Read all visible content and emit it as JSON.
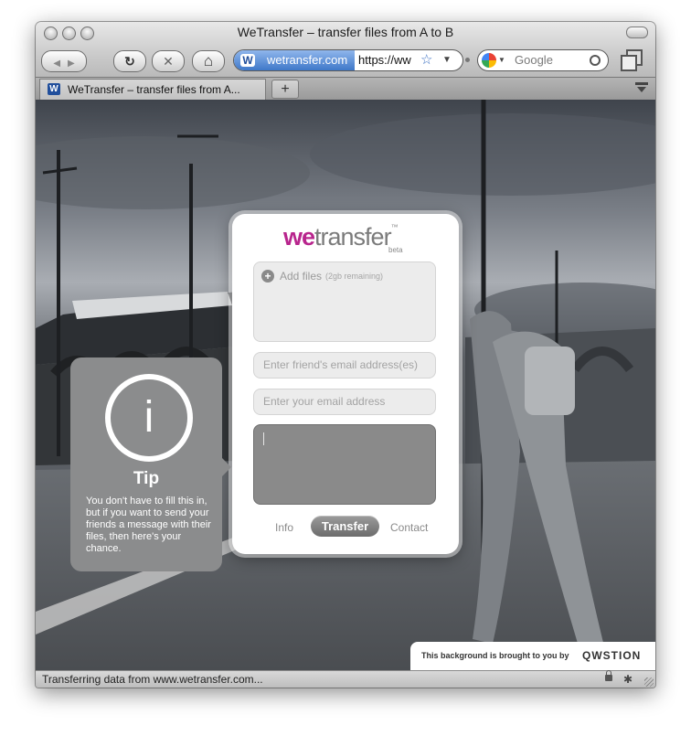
{
  "window": {
    "title": "WeTransfer – transfer files from A to B"
  },
  "toolbar": {
    "back_label": "◀",
    "forward_label": "▶",
    "reload_label": "↻",
    "stop_label": "✕",
    "home_label": "⌂",
    "site_identity": "wetransfer.com",
    "url": "https://ww",
    "search_placeholder": "Google"
  },
  "tabs": [
    {
      "label": "WeTransfer – transfer files from A..."
    }
  ],
  "new_tab_label": "+",
  "wetransfer": {
    "logo_we": "we",
    "logo_transfer": "transfer",
    "logo_tm": "™",
    "logo_beta": "beta",
    "add_files": "Add files",
    "add_files_note": "(2gb remaining)",
    "friends_email_placeholder": "Enter friend's email address(es)",
    "your_email_placeholder": "Enter your email address",
    "message_value": "",
    "info_label": "Info",
    "transfer_label": "Transfer",
    "contact_label": "Contact"
  },
  "tip": {
    "icon_letter": "i",
    "title": "Tip",
    "text": "You don't have to fill this in, but if you want to send your friends a message with their files, then here's your chance."
  },
  "background_credit": {
    "text": "This background is brought to you by",
    "brand": "QWSTION"
  },
  "status": {
    "text": "Transferring data from www.wetransfer.com..."
  },
  "colors": {
    "brand_magenta": "#c2268f",
    "brand_purple": "#6a2aa0",
    "identity_blue": "#3f78c9"
  }
}
